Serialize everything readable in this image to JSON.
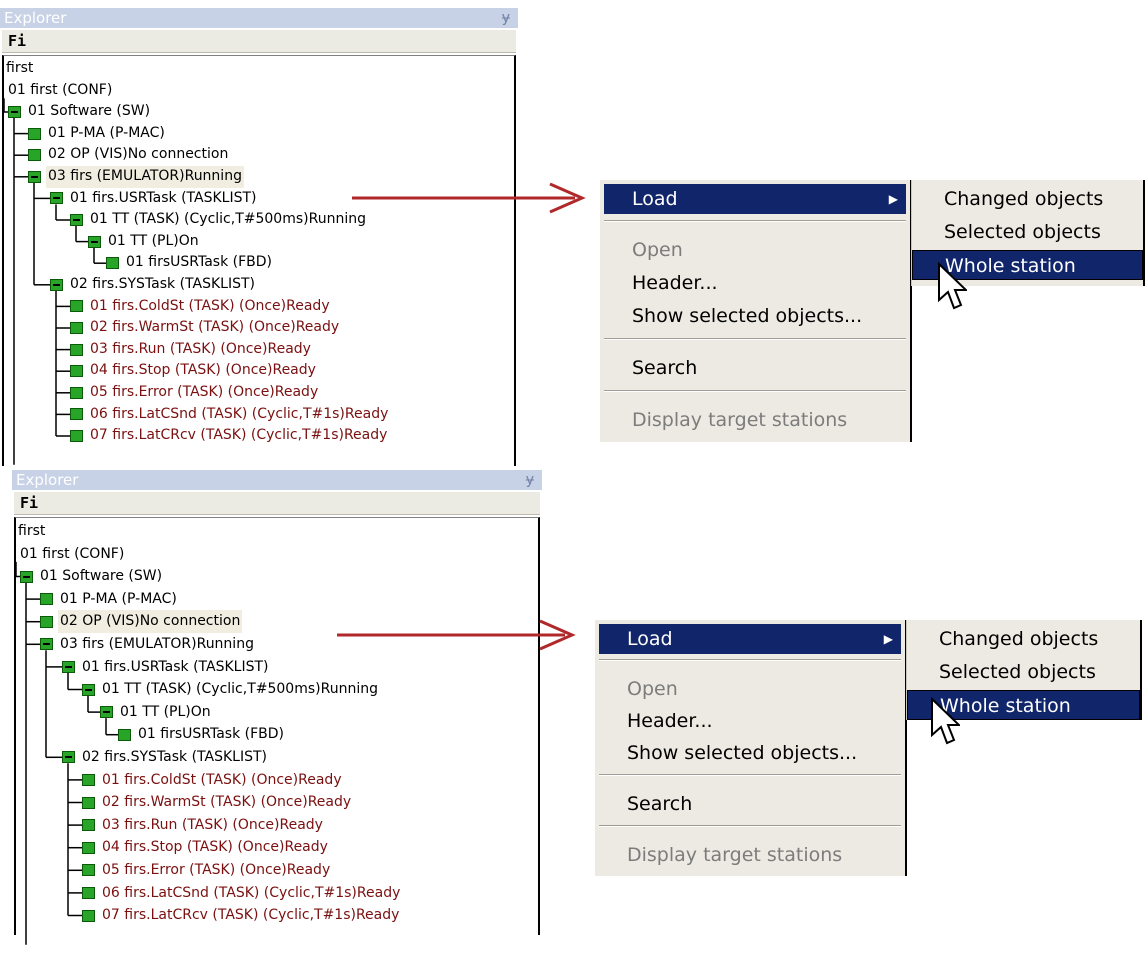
{
  "screens": [
    {
      "explorer": {
        "title": "Explorer",
        "pin_glyph": "ɏ",
        "toolbar_icon": "Fi",
        "tree": [
          {
            "text": "first"
          },
          {
            "text": "01  first  (CONF)"
          },
          {
            "text": "01  Software  (SW)",
            "icon": "minus"
          },
          {
            "text": "01  P-MA  (P-MAC)",
            "icon": "plain"
          },
          {
            "text": "02  OP  (VIS)No connection",
            "icon": "plain"
          },
          {
            "text": "03  firs  (EMULATOR)Running",
            "icon": "minus"
          },
          {
            "text": "01  firs.USRTask  (TASKLIST)",
            "icon": "minus"
          },
          {
            "text": "01  TT  (TASK) (Cyclic,T#500ms)Running",
            "icon": "minus"
          },
          {
            "text": "01  TT  (PL)On",
            "icon": "minus"
          },
          {
            "text": "01  firsUSRTask  (FBD)",
            "icon": "plain"
          },
          {
            "text": "02  firs.SYSTask  (TASKLIST)",
            "icon": "minus"
          },
          {
            "text": "01  firs.ColdSt  (TASK) (Once)Ready",
            "icon": "plain"
          },
          {
            "text": "02  firs.WarmSt  (TASK) (Once)Ready",
            "icon": "plain"
          },
          {
            "text": "03  firs.Run  (TASK) (Once)Ready",
            "icon": "plain"
          },
          {
            "text": "04  firs.Stop  (TASK) (Once)Ready",
            "icon": "plain"
          },
          {
            "text": "05  firs.Error  (TASK) (Once)Ready",
            "icon": "plain"
          },
          {
            "text": "06  firs.LatCSnd  (TASK) (Cyclic,T#1s)Ready",
            "icon": "plain"
          },
          {
            "text": "07  firs.LatCRcv  (TASK) (Cyclic,T#1s)Ready",
            "icon": "plain"
          }
        ]
      },
      "menu": {
        "items": [
          "Load",
          "Open",
          "Header...",
          "Show selected objects...",
          "Search",
          "Display target stations"
        ]
      },
      "submenu": {
        "items": [
          "Changed objects",
          "Selected objects",
          "Whole station"
        ]
      }
    },
    {
      "explorer": {
        "title": "Explorer",
        "pin_glyph": "ɏ",
        "toolbar_icon": "Fi",
        "tree": [
          {
            "text": "first"
          },
          {
            "text": "01  first  (CONF)"
          },
          {
            "text": "01  Software  (SW)",
            "icon": "minus"
          },
          {
            "text": "01  P-MA  (P-MAC)",
            "icon": "plain"
          },
          {
            "text": "02  OP  (VIS)No connection",
            "icon": "plain"
          },
          {
            "text": "03  firs  (EMULATOR)Running",
            "icon": "minus"
          },
          {
            "text": "01  firs.USRTask  (TASKLIST)",
            "icon": "minus"
          },
          {
            "text": "01  TT  (TASK) (Cyclic,T#500ms)Running",
            "icon": "minus"
          },
          {
            "text": "01  TT  (PL)On",
            "icon": "minus"
          },
          {
            "text": "01  firsUSRTask  (FBD)",
            "icon": "plain"
          },
          {
            "text": "02  firs.SYSTask  (TASKLIST)",
            "icon": "minus"
          },
          {
            "text": "01  firs.ColdSt  (TASK) (Once)Ready",
            "icon": "plain"
          },
          {
            "text": "02  firs.WarmSt  (TASK) (Once)Ready",
            "icon": "plain"
          },
          {
            "text": "03  firs.Run  (TASK) (Once)Ready",
            "icon": "plain"
          },
          {
            "text": "04  firs.Stop  (TASK) (Once)Ready",
            "icon": "plain"
          },
          {
            "text": "05  firs.Error  (TASK) (Once)Ready",
            "icon": "plain"
          },
          {
            "text": "06  firs.LatCSnd  (TASK) (Cyclic,T#1s)Ready",
            "icon": "plain"
          },
          {
            "text": "07  firs.LatCRcv  (TASK) (Cyclic,T#1s)Ready",
            "icon": "plain"
          }
        ]
      },
      "menu": {
        "items": [
          "Load",
          "Open",
          "Header...",
          "Show selected objects...",
          "Search",
          "Display target stations"
        ]
      },
      "submenu": {
        "items": [
          "Changed objects",
          "Selected objects",
          "Whole station"
        ]
      }
    }
  ],
  "colors": {
    "arrow": "#b0282a",
    "menu_highlight": "#10256a",
    "tree_icon": "#28a428",
    "error_text": "#7a1010"
  }
}
